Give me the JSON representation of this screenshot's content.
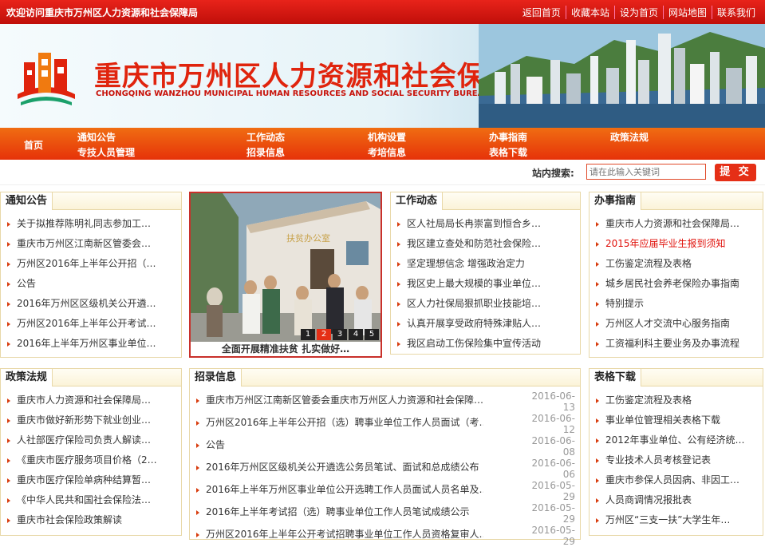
{
  "topbar": {
    "welcome": "欢迎访问重庆市万州区人力资源和社会保障局",
    "links": [
      "返回首页",
      "收藏本站",
      "设为首页",
      "网站地图",
      "联系我们"
    ]
  },
  "banner": {
    "title": "重庆市万州区人力资源和社会保障局",
    "subtitle": "CHONGQING WANZHOU MUNICIPAL HUMAN RESOURCES AND SOCIAL SECURITY BUREAU"
  },
  "nav": {
    "home": "首页",
    "items": [
      "通知公告",
      "工作动态",
      "机构设置",
      "办事指南",
      "政策法规",
      "专技人员管理",
      "招录信息",
      "考培信息",
      "表格下载"
    ]
  },
  "search": {
    "label": "站内搜索:",
    "placeholder": "请在此输入关键词",
    "button": "提 交"
  },
  "notice": {
    "title": "通知公告",
    "items": [
      "关于拟推荐陈明礼同志参加工…",
      "重庆市万州区江南新区管委会…",
      "万州区2016年上半年公开招（…",
      "公告",
      "2016年万州区区级机关公开遴…",
      "万州区2016年上半年公开考试…",
      "2016年上半年万州区事业单位…"
    ]
  },
  "slideshow": {
    "caption": "全面开展精准扶贫 扎实做好…",
    "pages": [
      "1",
      "2",
      "3",
      "4",
      "5"
    ],
    "active_page": "2",
    "sign": "扶贫办公室"
  },
  "work": {
    "title": "工作动态",
    "items": [
      "区人社局局长冉崇富到恒合乡…",
      "我区建立查处和防范社会保险…",
      "坚定理想信念 增强政治定力",
      "我区史上最大规模的事业单位…",
      "区人力社保局狠抓职业技能培…",
      "认真开展享受政府特殊津贴人…",
      "我区启动工伤保险集中宣传活动"
    ]
  },
  "guide": {
    "title": "办事指南",
    "items": [
      "重庆市人力资源和社会保障局…",
      "2015年应届毕业生报到须知",
      "工伤鉴定流程及表格",
      "城乡居民社会养老保险办事指南",
      "特别提示",
      "万州区人才交流中心服务指南",
      "工资福利科主要业务及办事流程"
    ]
  },
  "policy": {
    "title": "政策法规",
    "items": [
      "重庆市人力资源和社会保障局…",
      "重庆市做好新形势下就业创业…",
      "人社部医疗保险司负责人解读…",
      "《重庆市医疗服务项目价格（2…",
      "重庆市医疗保险单病种结算暂…",
      "《中华人民共和国社会保险法…",
      "重庆市社会保险政策解读"
    ]
  },
  "recruit": {
    "title": "招录信息",
    "items": [
      {
        "t": "重庆市万州区江南新区管委会重庆市万州区人力资源和社会保障…",
        "d": "2016-06-13"
      },
      {
        "t": "万州区2016年上半年公开招（选）聘事业单位工作人员面试（考…",
        "d": "2016-06-12"
      },
      {
        "t": "公告",
        "d": "2016-06-08"
      },
      {
        "t": "2016年万州区区级机关公开遴选公务员笔试、面试和总成绩公布",
        "d": "2016-06-06"
      },
      {
        "t": "2016年上半年万州区事业单位公开选聘工作人员面试人员名单及…",
        "d": "2016-05-29"
      },
      {
        "t": "2016年上半年考试招（选）聘事业单位工作人员笔试成绩公示",
        "d": "2016-05-29"
      },
      {
        "t": "万州区2016年上半年公开考试招聘事业单位工作人员资格复审人…",
        "d": "2016-05-29"
      }
    ]
  },
  "forms": {
    "title": "表格下载",
    "items": [
      "工伤鉴定流程及表格",
      "事业单位管理相关表格下载",
      "2012年事业单位、公有经济统…",
      "专业技术人员考核登记表",
      "重庆市参保人员因病、非因工…",
      "人员商调情况报批表",
      "万州区“三支一扶”大学生年…"
    ]
  }
}
